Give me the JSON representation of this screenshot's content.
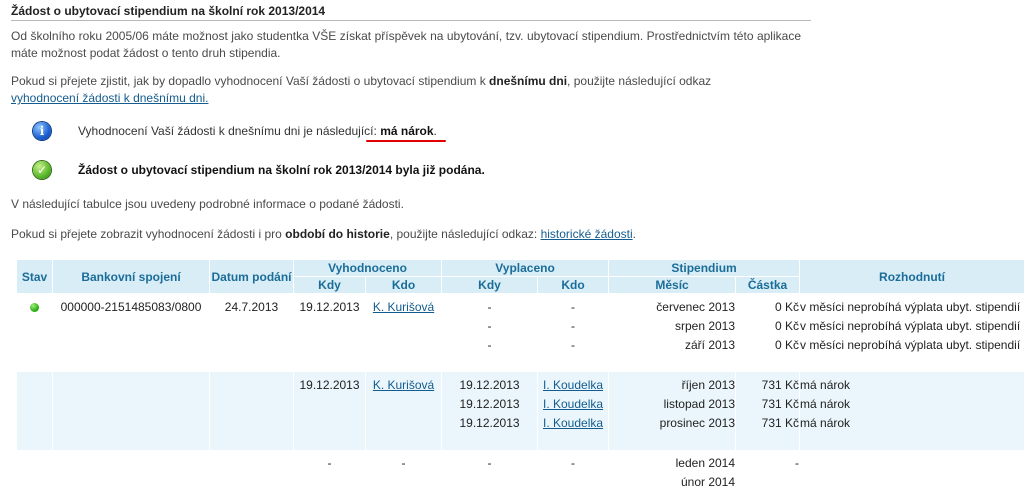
{
  "page": {
    "title": "Žádost o ubytovací stipendium na školní rok 2013/2014",
    "intro": "Od školního roku 2005/06 máte možnost jako studentka VŠE získat příspěvek na ubytování, tzv. ubytovací stipendium. Prostřednictvím této aplikace máte možnost podat žádost o tento druh stipendia.",
    "today_text_before": "Pokud si přejete zjistit, jak by dopadlo vyhodnocení Vaší žádosti o ubytovací stipendium k ",
    "today_bold": "dnešnímu dni",
    "today_text_after": ", použijte následující odkaz",
    "today_link": "vyhodnocení žádosti k dnešnímu dni.",
    "info_notice": "Vyhodnocení Vaší žádosti k dnešnímu dni je následující: ",
    "info_result": "má nárok",
    "info_suffix": ".",
    "success_notice": "Žádost o ubytovací stipendium na školní rok 2013/2014 byla již podána.",
    "table_intro": "V následující tabulce jsou uvedeny podrobné informace o podané žádosti.",
    "history_text_before": "Pokud si přejete zobrazit vyhodnocení žádosti i pro ",
    "history_bold": "období do historie",
    "history_text_after": ", použijte následující odkaz: ",
    "history_link": "historické žádosti",
    "history_suffix": "."
  },
  "table": {
    "headers": {
      "stav": "Stav",
      "bank": "Bankovní spojení",
      "datum": "Datum podání",
      "vyhodnoceno": "Vyhodnoceno",
      "vyplaceno": "Vyplaceno",
      "stipendium": "Stipendium",
      "rozhodnuti": "Rozhodnutí",
      "kdy": "Kdy",
      "kdo": "Kdo",
      "kdy2": "Kdy",
      "kdo2": "Kdo",
      "mesic": "Měsíc",
      "castka": "Částka"
    },
    "rows": [
      {
        "status_color": "#1fa50a",
        "bank": "000000-2151485083/0800",
        "datum": "24.7.2013",
        "vyh_kdy": "19.12.2013",
        "vyh_kdo": "K. Kurišová",
        "vyp_kdy": [
          "-",
          "-",
          "-"
        ],
        "vyp_kdo": [
          "-",
          "-",
          "-"
        ],
        "mesic": [
          "červenec 2013",
          "srpen 2013",
          "září 2013"
        ],
        "castka": [
          "0 Kč",
          "0 Kč",
          "0 Kč"
        ],
        "rozhodnuti": [
          "v měsíci neprobíhá výplata ubyt. stipendií",
          "v měsíci neprobíhá výplata ubyt. stipendií",
          "v měsíci neprobíhá výplata ubyt. stipendií"
        ]
      },
      {
        "vyh_kdy": "19.12.2013",
        "vyh_kdo": "K. Kurišová",
        "vyp_kdy": [
          "19.12.2013",
          "19.12.2013",
          "19.12.2013"
        ],
        "vyp_kdo": [
          "I. Koudelka",
          "I. Koudelka",
          "I. Koudelka"
        ],
        "mesic": [
          "říjen 2013",
          "listopad 2013",
          "prosinec 2013"
        ],
        "castka": [
          "731 Kč",
          "731 Kč",
          "731 Kč"
        ],
        "rozhodnuti": [
          "má nárok",
          "má nárok",
          "má nárok"
        ]
      },
      {
        "vyh_kdy": "-",
        "vyh_kdo": "-",
        "vyp_kdy": [
          "-"
        ],
        "vyp_kdo": [
          "-"
        ],
        "mesic": [
          "leden 2014",
          "únor 2014"
        ],
        "castka": [
          "-"
        ],
        "rozhodnuti": []
      }
    ]
  }
}
